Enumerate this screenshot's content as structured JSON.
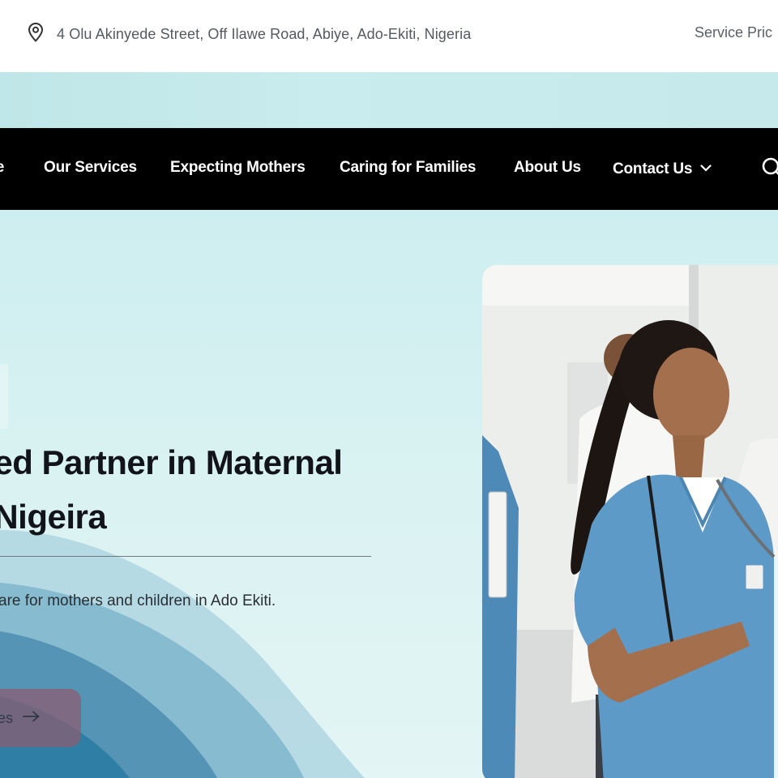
{
  "topbar": {
    "address": "4 Olu Akinyede Street, Off Ilawe Road, Abiye, Ado-Ekiti, Nigeria",
    "address_icon": "map-pin-icon",
    "right_link": "Service Pric"
  },
  "nav": {
    "items": [
      {
        "label": "me"
      },
      {
        "label": "Our Services"
      },
      {
        "label": "Expecting Mothers"
      },
      {
        "label": "Caring for Families"
      },
      {
        "label": "About Us"
      },
      {
        "label": "Contact Us"
      }
    ],
    "search_icon": "search-icon",
    "chevron_icon": "chevron-down-icon"
  },
  "hero": {
    "headline_line1": "sted Partner in Maternal",
    "headline_line2": "n Nigeira",
    "subtext": "are for mothers and children in Ado Ekiti.",
    "cta_label": "ces",
    "cta_icon": "arrow-right-icon",
    "photo_alt": "nurse-in-scrubs-photo"
  },
  "colors": {
    "nav_bg": "#000000",
    "strip": "#c6eaec",
    "wave_dark": "#2f7ea6",
    "wave_mid": "#7fb6cc",
    "cta": "#8f5c70",
    "scrubs": "#5d9ac8"
  }
}
